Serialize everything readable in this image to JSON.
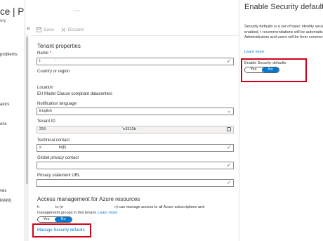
{
  "left_blade": {
    "title": "ce | Properties",
    "subtitle": "ory",
    "nav_items": [
      "problems",
      "ators",
      "ons",
      "ves",
      "MAM)"
    ]
  },
  "middle": {
    "ellipsis": "···",
    "toolbar": {
      "save_label": "Save",
      "discard_label": "Discard"
    },
    "tenant_section_title": "Tenant properties",
    "name": {
      "label": "Name",
      "required_marker": "*",
      "value": "t",
      "value_end": "-"
    },
    "country": {
      "label": "Country or region"
    },
    "location": {
      "label": "Location",
      "value": "EU Model Clause compliant datacenters"
    },
    "notification_language": {
      "label": "Notification language",
      "value": "English"
    },
    "tenant_id": {
      "label": "Tenant ID",
      "value_start": "259",
      "value_end": "'e3313b"
    },
    "technical_contact": {
      "label": "Technical contact",
      "value_start": "s",
      "value_end": "b@("
    },
    "global_privacy_contact": {
      "label": "Global privacy contact"
    },
    "privacy_statement_url": {
      "label": "Privacy statement URL"
    },
    "access_section_title": "Access management for Azure resources",
    "access_text_a": "h",
    "access_text_b": "in (n",
    "access_text_c": "n) can manage access to all Azure subscriptions and",
    "access_text_d": "management groups in this tenant.",
    "learn_more": "Learn more",
    "access_toggle": {
      "yes": "Yes",
      "no": "No",
      "selected": "No"
    },
    "manage_link": "Manage Security defaults"
  },
  "right_blade": {
    "title": "Enable Security defaults",
    "description": "Security defaults is a set of basic identity secu recommended by Microsoft. When enabled, t recommendations will be automatically enforc organization. Administrators and users will be from common identity related attacks.",
    "learn_more": "Learn more",
    "toggle_label": "Enable Security defaults",
    "toggle": {
      "yes": "Yes",
      "no": "No",
      "selected": "No"
    }
  },
  "colors": {
    "accent": "#0078d4",
    "highlight": "#d0021b",
    "valid": "#107c10"
  }
}
